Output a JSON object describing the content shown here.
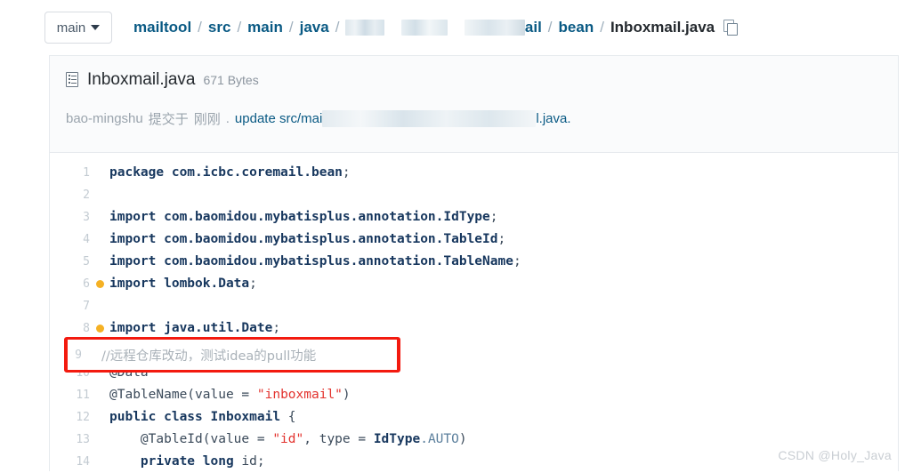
{
  "topbar": {
    "branch": {
      "label": "main",
      "caret_icon": "chevron-down-icon"
    },
    "breadcrumb": {
      "separator": "/",
      "items": [
        {
          "label": "mailtool",
          "type": "link"
        },
        {
          "label": "src",
          "type": "link"
        },
        {
          "label": "main",
          "type": "link"
        },
        {
          "label": "java",
          "type": "link"
        },
        {
          "label": "",
          "type": "redacted"
        },
        {
          "label": "ail",
          "type": "link"
        },
        {
          "label": "bean",
          "type": "link"
        },
        {
          "label": "Inboxmail.java",
          "type": "current"
        }
      ],
      "copy_icon": "copy-icon"
    }
  },
  "file": {
    "icon": "file-document-icon",
    "name": "Inboxmail.java",
    "size": "671 Bytes",
    "commit": {
      "author": "bao-mingshu",
      "action": "提交于",
      "time": "刚刚",
      "dot": ".",
      "message_head": "update src/mai",
      "message_tail": "l.java."
    }
  },
  "code": {
    "lines": [
      {
        "no": "1",
        "warn": false,
        "tokens": [
          {
            "t": "package ",
            "c": "tok-kw"
          },
          {
            "t": "com.icbc.coremail.bean",
            "c": "tok-plain"
          },
          {
            "t": ";",
            "c": "tok-punc"
          }
        ]
      },
      {
        "no": "2",
        "warn": false,
        "tokens": []
      },
      {
        "no": "3",
        "warn": false,
        "tokens": [
          {
            "t": "import ",
            "c": "tok-kw"
          },
          {
            "t": "com.baomidou.mybatisplus.annotation.IdType",
            "c": "tok-plain"
          },
          {
            "t": ";",
            "c": "tok-punc"
          }
        ]
      },
      {
        "no": "4",
        "warn": false,
        "tokens": [
          {
            "t": "import ",
            "c": "tok-kw"
          },
          {
            "t": "com.baomidou.mybatisplus.annotation.TableId",
            "c": "tok-plain"
          },
          {
            "t": ";",
            "c": "tok-punc"
          }
        ]
      },
      {
        "no": "5",
        "warn": false,
        "tokens": [
          {
            "t": "import ",
            "c": "tok-kw"
          },
          {
            "t": "com.baomidou.mybatisplus.annotation.TableName",
            "c": "tok-plain"
          },
          {
            "t": ";",
            "c": "tok-punc"
          }
        ]
      },
      {
        "no": "6",
        "warn": true,
        "tokens": [
          {
            "t": "import ",
            "c": "tok-kw"
          },
          {
            "t": "lombok.Data",
            "c": "tok-plain"
          },
          {
            "t": ";",
            "c": "tok-punc"
          }
        ]
      },
      {
        "no": "7",
        "warn": false,
        "tokens": []
      },
      {
        "no": "8",
        "warn": true,
        "tokens": [
          {
            "t": "import ",
            "c": "tok-kw"
          },
          {
            "t": "java.util.Date",
            "c": "tok-plain"
          },
          {
            "t": ";",
            "c": "tok-punc"
          }
        ]
      },
      {
        "no": "9",
        "warn": false,
        "tokens": [
          {
            "t": "//远程仓库改动，测试idea的pull功能",
            "c": "tok-comment"
          }
        ]
      },
      {
        "no": "10",
        "warn": false,
        "tokens": [
          {
            "t": "@Data",
            "c": "tok-anno"
          }
        ]
      },
      {
        "no": "11",
        "warn": false,
        "tokens": [
          {
            "t": "@TableName(value = ",
            "c": "tok-anno"
          },
          {
            "t": "\"inboxmail\"",
            "c": "tok-str"
          },
          {
            "t": ")",
            "c": "tok-anno"
          }
        ]
      },
      {
        "no": "12",
        "warn": false,
        "tokens": [
          {
            "t": "public class ",
            "c": "tok-kw"
          },
          {
            "t": "Inboxmail",
            "c": "tok-type"
          },
          {
            "t": " {",
            "c": "tok-punc"
          }
        ]
      },
      {
        "no": "13",
        "warn": false,
        "tokens": [
          {
            "t": "    @TableId(value = ",
            "c": "tok-anno"
          },
          {
            "t": "\"id\"",
            "c": "tok-str"
          },
          {
            "t": ", type = ",
            "c": "tok-anno"
          },
          {
            "t": "IdType",
            "c": "tok-type"
          },
          {
            "t": ".AUTO",
            "c": "tok-const"
          },
          {
            "t": ")",
            "c": "tok-anno"
          }
        ]
      },
      {
        "no": "14",
        "warn": false,
        "tokens": [
          {
            "t": "    private long ",
            "c": "tok-kw"
          },
          {
            "t": "id",
            "c": "tok-anno"
          },
          {
            "t": ";",
            "c": "tok-punc"
          }
        ]
      }
    ],
    "annotation_comment": "//远程仓库改动，测试idea的pull功能",
    "annotation_lineno": "9",
    "annotation_color": "#f31a0f"
  },
  "watermark": "CSDN @Holy_Java"
}
